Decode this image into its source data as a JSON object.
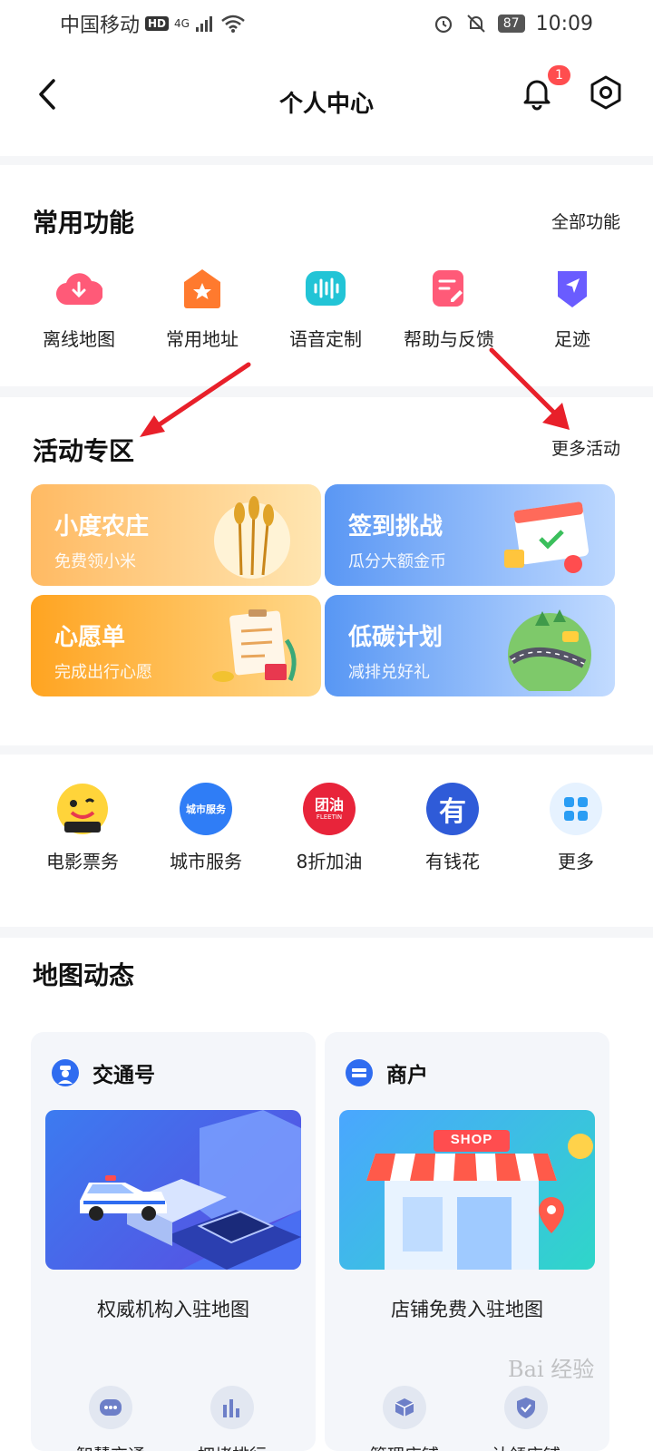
{
  "status_bar": {
    "carrier": "中国移动",
    "hd": "HD",
    "network": "4G",
    "battery": "87",
    "time": "10:09"
  },
  "header": {
    "title": "个人中心",
    "notification_count": "1"
  },
  "common_functions": {
    "title": "常用功能",
    "all_link": "全部功能",
    "items": [
      {
        "label": "离线地图",
        "icon": "cloud-download-icon",
        "color": "#ff5a78"
      },
      {
        "label": "常用地址",
        "icon": "home-star-icon",
        "color": "#ff7a2e"
      },
      {
        "label": "语音定制",
        "icon": "voice-wave-icon",
        "color": "#22c4d6"
      },
      {
        "label": "帮助与反馈",
        "icon": "feedback-edit-icon",
        "color": "#ff5a78"
      },
      {
        "label": "足迹",
        "icon": "location-arrow-icon",
        "color": "#6a5cff"
      }
    ]
  },
  "activities": {
    "title": "活动专区",
    "more_link": "更多活动",
    "cards": [
      {
        "title": "小度农庄",
        "subtitle": "免费领小米",
        "color_from": "#ffbf6b",
        "color_to": "#ffe8b8"
      },
      {
        "title": "签到挑战",
        "subtitle": "瓜分大额金币",
        "color_from": "#5e9bf5",
        "color_to": "#bcd8ff"
      },
      {
        "title": "心愿单",
        "subtitle": "完成出行心愿",
        "color_from": "#ffa826",
        "color_to": "#ffd98a"
      },
      {
        "title": "低碳计划",
        "subtitle": "减排兑好礼",
        "color_from": "#5a9af4",
        "color_to": "#c4dcff"
      }
    ]
  },
  "services": {
    "items": [
      {
        "label": "电影票务",
        "icon": "movie-ticket-icon"
      },
      {
        "label": "城市服务",
        "icon": "city-service-icon",
        "icon_text": "城市服务"
      },
      {
        "label": "8折加油",
        "icon": "fuel-icon",
        "icon_text": "团油",
        "icon_subtext": "FLEETIN"
      },
      {
        "label": "有钱花",
        "icon": "youqianhua-icon",
        "icon_text": "有"
      },
      {
        "label": "更多",
        "icon": "grid-more-icon"
      }
    ]
  },
  "map_dynamic": {
    "title": "地图动态",
    "cards": [
      {
        "title": "交通号",
        "icon": "police-officer-icon",
        "caption": "权威机构入驻地图",
        "subs": [
          {
            "label": "智慧交通",
            "icon": "chat-dots-icon"
          },
          {
            "label": "拥堵排行",
            "icon": "bar-chart-icon"
          }
        ]
      },
      {
        "title": "商户",
        "icon": "merchant-icon",
        "caption": "店铺免费入驻地图",
        "shop_sign": "SHOP",
        "subs": [
          {
            "label": "管理店铺",
            "icon": "box-icon"
          },
          {
            "label": "认领店铺",
            "icon": "shield-check-icon"
          }
        ]
      }
    ]
  },
  "watermark": "Bai 经验"
}
